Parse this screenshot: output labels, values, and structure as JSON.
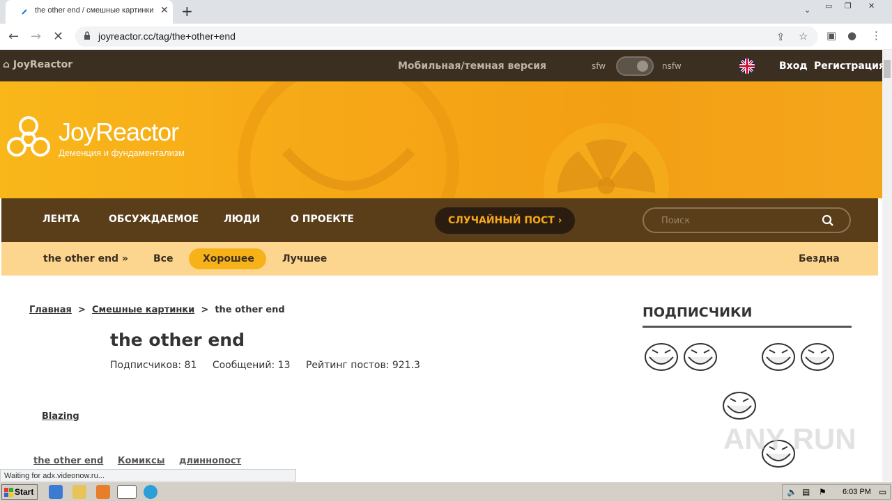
{
  "browser": {
    "tab_title": "the other end / смешные картинки",
    "tab_close": "✕",
    "new_tab": "+",
    "url": "joyreactor.cc/tag/the+other+end",
    "status": "Waiting for adx.videonow.ru..."
  },
  "topbar": {
    "logo": "JoyReactor",
    "mobile": "Мобильная/темная версия",
    "sfw": "sfw",
    "nsfw": "nsfw",
    "login": "Вход",
    "register": "Регистрация"
  },
  "banner": {
    "brand": "JoyReactor",
    "slogan": "Деменция и фундаментализм"
  },
  "nav": {
    "items": [
      "ЛЕНТА",
      "ОБСУЖДАЕМОЕ",
      "ЛЮДИ",
      "О ПРОЕКТЕ"
    ],
    "random": "СЛУЧАЙНЫЙ ПОСТ  ›",
    "search_placeholder": "Поиск"
  },
  "subnav": {
    "tag": "the other end »",
    "all": "Все",
    "good": "Хорошее",
    "best": "Лучшее",
    "abyss": "Бездна"
  },
  "breadcrumb": {
    "home": "Главная",
    "sep": ">",
    "section": "Смешные картинки",
    "current": "the other end"
  },
  "tag_page": {
    "title": "the other end",
    "subscribers": "Подписчиков: 81",
    "posts": "Сообщений: 13",
    "rating": "Рейтинг постов: 921.3"
  },
  "post": {
    "author": "Blazing",
    "tags": [
      "the other end",
      "Комиксы",
      "длиннопост"
    ]
  },
  "sidebar": {
    "title": "ПОДПИСЧИКИ"
  },
  "watermark": "ANY RUN",
  "taskbar": {
    "start": "Start",
    "clock": "6:03 PM"
  }
}
